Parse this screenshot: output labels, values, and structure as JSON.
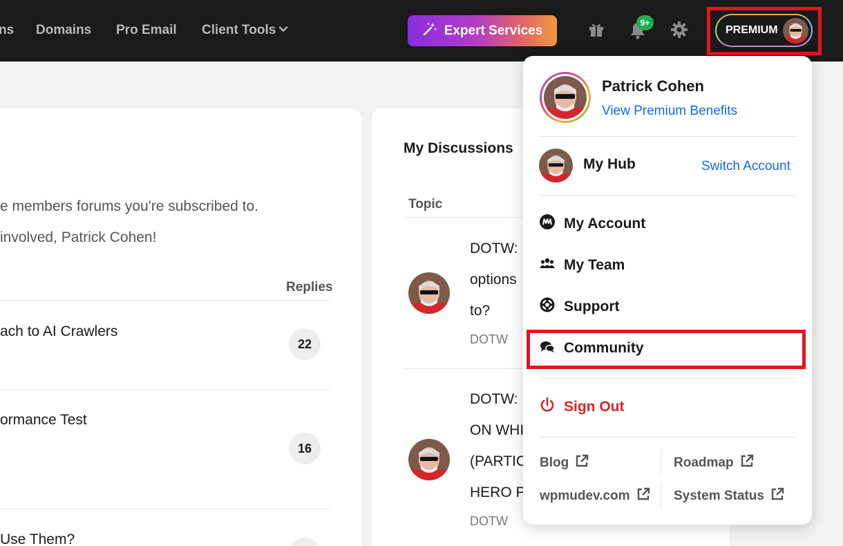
{
  "nav": {
    "items": [
      "ns",
      "Domains",
      "Pro Email",
      "Client Tools"
    ],
    "expert_label": "Expert Services",
    "notification_badge": "9+",
    "premium_label": "PREMIUM"
  },
  "left_panel": {
    "line1": "e members forums you're subscribed to.",
    "line2": "involved, Patrick Cohen!",
    "replies_header": "Replies",
    "rows": [
      {
        "title": "ach to AI Crawlers",
        "replies": "22"
      },
      {
        "title": "ormance Test",
        "replies": "16"
      },
      {
        "title": " Use Them?",
        "replies": ""
      }
    ]
  },
  "discussions": {
    "title": "My Discussions",
    "topic_header": "Topic",
    "items": [
      {
        "lines": [
          "DOTW:",
          "options",
          "to?"
        ],
        "tag": "DOTW"
      },
      {
        "lines": [
          "DOTW: ",
          "ON WHI",
          "(PARTIC",
          "HERO P"
        ],
        "tag": "DOTW"
      }
    ]
  },
  "dropdown": {
    "user_name": "Patrick Cohen",
    "view_benefits": "View Premium Benefits",
    "hub_label": "My Hub",
    "switch_account": "Switch Account",
    "menu": [
      "My Account",
      "My Team",
      "Support",
      "Community"
    ],
    "sign_out": "Sign Out",
    "footer": [
      "Blog",
      "Roadmap",
      "wpmudev.com",
      "System Status"
    ]
  },
  "colors": {
    "highlight": "#e0171f",
    "link": "#1468e6",
    "danger": "#d9262a"
  }
}
